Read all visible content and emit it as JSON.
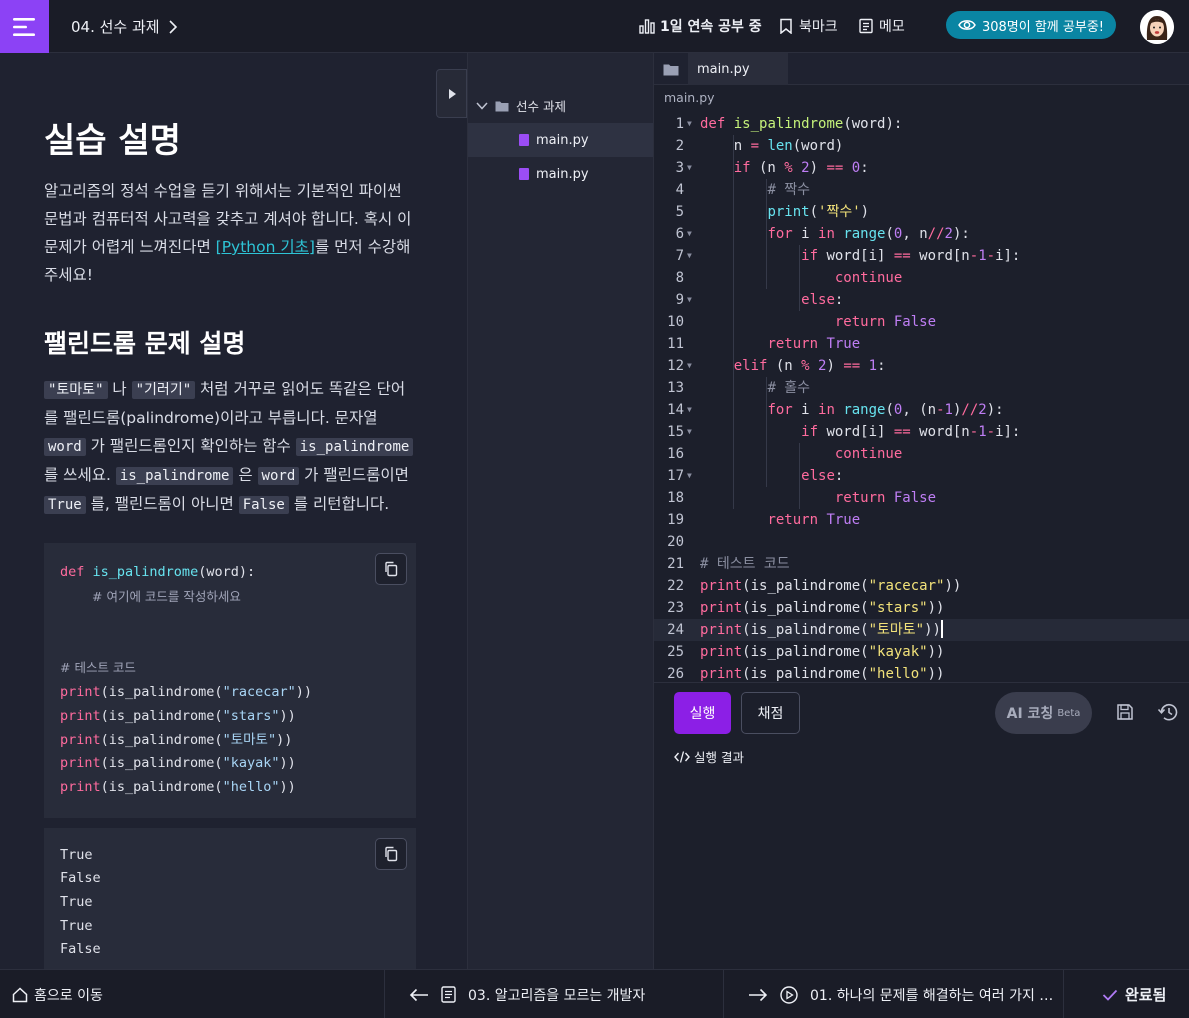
{
  "header": {
    "breadcrumb": "04. 선수 과제",
    "streak": "1일 연속 공부 중",
    "bookmark": "북마크",
    "memo": "메모",
    "studying_now": "308명이 함께 공부중!"
  },
  "description": {
    "title": "실습 설명",
    "intro_before": "알고리즘의 정석 수업을 듣기 위해서는 기본적인 파이썬 문법과 컴퓨터적 사고력을 갖추고 계셔야 합니다. 혹시 이 문제가 어렵게 느껴진다면 ",
    "intro_link": "[Python 기초]",
    "intro_after": "를 먼저 수강해 주세요!",
    "problem_title": "팰린드롬 문제 설명",
    "p_code1": "\"토마토\"",
    "p_t1": " 나 ",
    "p_code2": "\"기러기\"",
    "p_t2": " 처럼 거꾸로 읽어도 똑같은 단어를 팰린드롬(palindrome)이라고 부릅니다. 문자열 ",
    "p_code3": "word",
    "p_t3": " 가 팰린드롬인지 확인하는 함수 ",
    "p_code4": "is_palindrome",
    "p_t4": " 를 쓰세요. ",
    "p_code5": "is_palindrome",
    "p_t5": " 은 ",
    "p_code6": "word",
    "p_t6": " 가 팰린드롬이면 ",
    "p_code7": "True",
    "p_t7": " 를, 팰린드롬이 아니면 ",
    "p_code8": "False",
    "p_t8": " 를 리턴합니다.",
    "example_code": {
      "def_kw": "def",
      "fn_name": "is_palindrome",
      "fn_args": "(word):",
      "comment": "# 여기에 코드를 작성하세요",
      "test_comment": "# 테스트 코드",
      "print_kw": "print",
      "call_fn": "(is_palindrome(",
      "tests": [
        "\"racecar\"",
        "\"stars\"",
        "\"토마토\"",
        "\"kayak\"",
        "\"hello\""
      ],
      "close": "))"
    },
    "output_lines": [
      "True",
      "False",
      "True",
      "True",
      "False"
    ]
  },
  "filetree": {
    "folder": "선수 과제",
    "files": [
      "main.py",
      "main.py"
    ]
  },
  "editor": {
    "tab": "main.py",
    "path": "main.py",
    "line_numbers": [
      "1",
      "2",
      "3",
      "4",
      "5",
      "6",
      "7",
      "8",
      "9",
      "10",
      "11",
      "12",
      "13",
      "14",
      "15",
      "16",
      "17",
      "18",
      "19",
      "20",
      "21",
      "22",
      "23",
      "24",
      "25",
      "26"
    ],
    "run": "실행",
    "grade": "채점",
    "ai": "AI 코칭",
    "ai_beta": "Beta",
    "result_label": "실행 결과"
  },
  "footer": {
    "home": "홈으로 이동",
    "prev": "03. 알고리즘을 모르는 개발자",
    "next": "01. 하나의 문제를 해결하는 여러 가지 …",
    "done": "완료됨"
  },
  "colors": {
    "accent": "#8c42f5",
    "run": "#8c1fe6",
    "studying_pill": "#0a85a3",
    "link": "#2ec4d6"
  }
}
